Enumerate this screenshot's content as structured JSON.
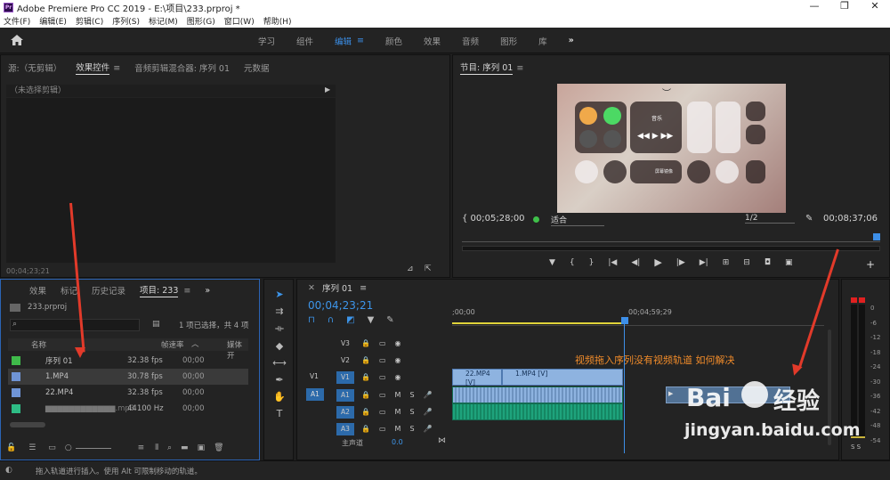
{
  "app": {
    "title": "Adobe Premiere Pro CC 2019 - E:\\项目\\233.prproj *",
    "min": "—",
    "max": "❐",
    "close": "✕"
  },
  "menu": [
    "文件(F)",
    "编辑(E)",
    "剪辑(C)",
    "序列(S)",
    "标记(M)",
    "图形(G)",
    "窗口(W)",
    "帮助(H)"
  ],
  "workspace": {
    "tabs": [
      "学习",
      "组件",
      "编辑",
      "颜色",
      "效果",
      "音频",
      "图形",
      "库"
    ],
    "active": "编辑",
    "more": "»"
  },
  "source": {
    "tabs": [
      "源:（无剪辑）",
      "效果控件",
      "音频剪辑混合器: 序列 01",
      "元数据"
    ],
    "no_clip": "（未选择剪辑）",
    "timecode": "00;04;23;21"
  },
  "program": {
    "title": "节目: 序列 01",
    "tc_left": "{ 00;05;28;00",
    "fit": "适合",
    "ratio": "1/2",
    "tc_right": "00;08;37;06",
    "music_label": "音乐",
    "mirror_label": "屏幕镜像"
  },
  "project": {
    "tabs": [
      "效果",
      "标记",
      "历史记录",
      "项目: 233"
    ],
    "file": "233.prproj",
    "selection": "1 项已选择，共 4 项",
    "cols": {
      "name": "名称",
      "fps": "帧速率",
      "media": "媒体开"
    },
    "rows": [
      {
        "name": "序列 01",
        "fps": "32.38 fps",
        "start": "00;00",
        "color": "#3fba4a"
      },
      {
        "name": "1.MP4",
        "fps": "30.78 fps",
        "start": "00;00",
        "color": "#6f94d6"
      },
      {
        "name": "22.MP4",
        "fps": "32.38 fps",
        "start": "00;00",
        "color": "#6f94d6"
      },
      {
        "name": "▆▆▆▆▆▆▆▆▆▆▆▆.mp3",
        "fps": "44100 Hz",
        "start": "00;00",
        "color": "#2ebc85"
      }
    ]
  },
  "timeline": {
    "title": "序列 01",
    "timecode": "00;04;23;21",
    "ruler_start": ";00;00",
    "ruler_mid": "00;04;59;29",
    "tracks": [
      {
        "name": "V3",
        "kind": "video"
      },
      {
        "name": "V2",
        "kind": "video"
      },
      {
        "name": "V1",
        "kind": "video",
        "src": "V1"
      },
      {
        "name": "A1",
        "kind": "audio",
        "src": "A1"
      },
      {
        "name": "A2",
        "kind": "audio"
      },
      {
        "name": "A3",
        "kind": "audio"
      }
    ],
    "master": "主声道",
    "master_val": "0.0",
    "clips": {
      "c1": "22.MP4 [V]",
      "c2": "1.MP4 [V]"
    },
    "annotation": "视频拖入序列没有视频轨道  如何解决"
  },
  "meter": {
    "labels": [
      "0",
      "-6",
      "-12",
      "-18",
      "-24",
      "-30",
      "-36",
      "-42",
      "-48",
      "-54"
    ],
    "solo": "S S"
  },
  "status": {
    "text": "拖入轨道进行插入。使用 Alt 可限制移动的轨道。"
  },
  "watermark": {
    "brand": "Bai",
    "brand2": "经验",
    "url": "jingyan.baidu.com"
  }
}
